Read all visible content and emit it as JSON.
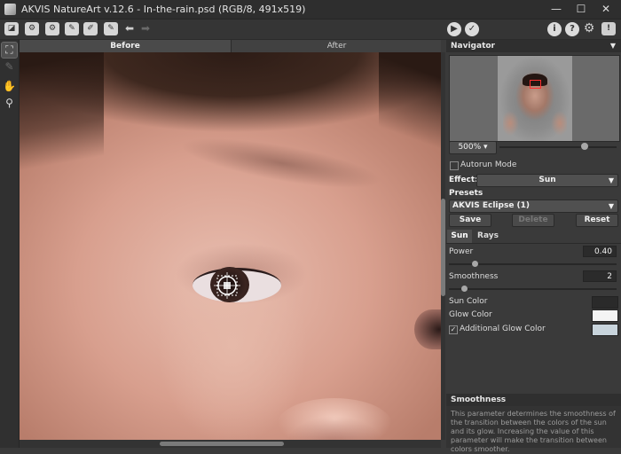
{
  "window": {
    "title": "AKVIS NatureArt v.12.6 - In-the-rain.psd (RGB/8, 491x519)"
  },
  "toolbar": {
    "buttons": [
      "open-icon",
      "batch-icon",
      "preset-icon",
      "brush-icon",
      "tools-icon",
      "settings-icon",
      "undo-icon",
      "redo-icon"
    ],
    "right_buttons": [
      "run-icon",
      "apply-icon",
      "info-icon",
      "help-icon",
      "gear-icon",
      "notification-icon"
    ]
  },
  "view_tabs": {
    "before": "Before",
    "after": "After"
  },
  "navigator": {
    "title": "Navigator",
    "zoom": "500%",
    "zoom_level": 0.72
  },
  "autorun": {
    "label": "Autorun Mode",
    "checked": false
  },
  "effect": {
    "label": "Effect:",
    "value": "Sun"
  },
  "presets": {
    "title": "Presets",
    "selected": "AKVIS Eclipse (1)",
    "save": "Save",
    "delete": "Delete",
    "reset": "Reset"
  },
  "param_tabs": {
    "sun": "Sun",
    "rays": "Rays"
  },
  "params": {
    "power": {
      "label": "Power",
      "value": "0.40",
      "level": 0.25
    },
    "smoothness": {
      "label": "Smoothness",
      "value": "2",
      "level": 0.1
    },
    "sun_color": {
      "label": "Sun Color",
      "color": "#2a2a2a"
    },
    "glow_color": {
      "label": "Glow Color",
      "color": "#f4f4f4"
    },
    "additional_glow": {
      "label": "Additional Glow Color",
      "checked": true,
      "color": "#c8d4dc"
    }
  },
  "hint": {
    "title": "Smoothness",
    "text": "This parameter determines the smoothness of the transition between the colors of the sun and its glow. Increasing the value of this parameter will make the transition between colors smoother."
  },
  "colors": {
    "accent_red": "#ff3030",
    "panel_bg": "#3a3a3a"
  }
}
